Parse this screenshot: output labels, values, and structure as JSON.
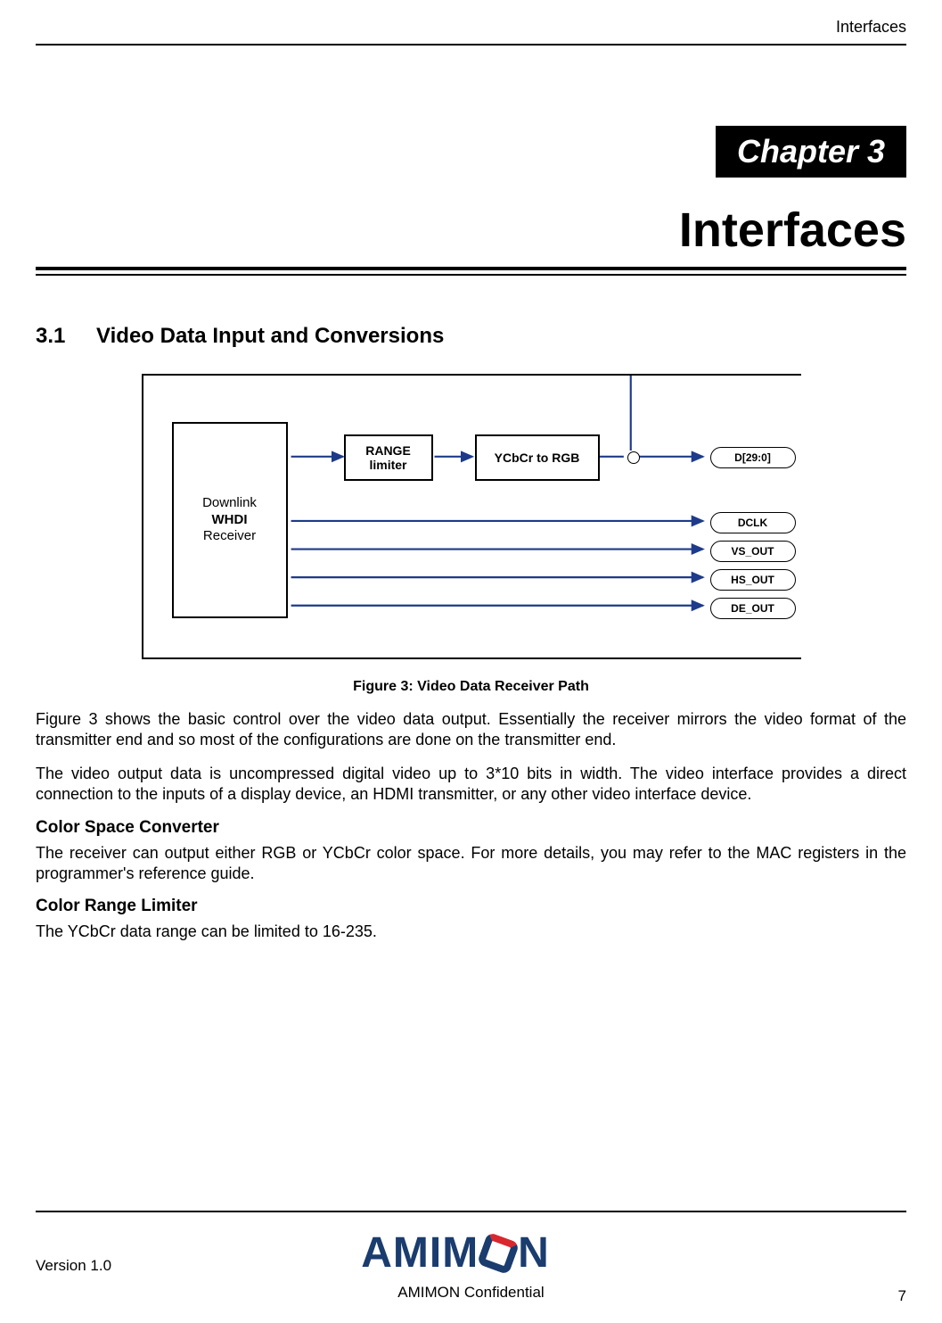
{
  "header": {
    "section": "Interfaces"
  },
  "chapter": {
    "banner": "Chapter 3",
    "title": "Interfaces"
  },
  "section": {
    "number": "3.1",
    "title": "Video Data Input and Conversions"
  },
  "diagram": {
    "receiver_l1": "Downlink",
    "receiver_l2": "WHDI",
    "receiver_l3": "Receiver",
    "range_l1": "RANGE",
    "range_l2": "limiter",
    "ycbcr": "YCbCr to RGB",
    "pills": {
      "d": "D[29:0]",
      "dclk": "DCLK",
      "vs": "VS_OUT",
      "hs": "HS_OUT",
      "de": "DE_OUT"
    },
    "caption": "Figure 3: Video Data Receiver Path"
  },
  "paragraphs": {
    "p1": "Figure 3 shows the basic control over the video data output. Essentially the receiver mirrors the video format of the transmitter end and so most of the configurations are done on the transmitter end.",
    "p2": "The video output data is uncompressed digital video up to 3*10 bits in width. The video interface provides a direct connection to the inputs of a display device, an HDMI transmitter, or any other video interface device."
  },
  "sub1": {
    "heading": "Color Space Converter",
    "text": "The receiver can output either RGB or YCbCr color space. For more details, you may refer to the MAC registers in the programmer's reference guide."
  },
  "sub2": {
    "heading": "Color Range Limiter",
    "text": "The YCbCr data range can be limited to 16-235."
  },
  "footer": {
    "version": "Version 1.0",
    "logo_pre": "AMIM",
    "logo_post": "N",
    "confidential": "AMIMON Confidential",
    "page": "7"
  }
}
